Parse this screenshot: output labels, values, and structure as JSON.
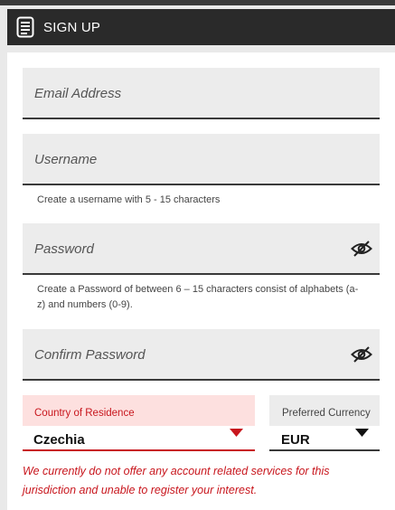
{
  "header": {
    "title": "SIGN UP",
    "icon": "document-icon"
  },
  "form": {
    "email_placeholder": "Email Address",
    "username_placeholder": "Username",
    "username_hint": "Create a username with 5 - 15 characters",
    "password_placeholder": "Password",
    "password_hint_line1": "Create a Password of between 6 – 15 characters consist of alphabets (a-",
    "password_hint_line2": "z) and numbers (0-9).",
    "confirm_password_placeholder": "Confirm Password",
    "country_label": "Country of Residence",
    "country_value": "Czechia",
    "currency_label": "Preferred Currency",
    "currency_value": "EUR",
    "error_line1": "We currently do not offer any account related services for this",
    "error_line2": "jurisdiction and unable to register your interest."
  },
  "colors": {
    "error": "#c8161d",
    "error_bg": "#fde0df",
    "header_bg": "#2a2a2a"
  }
}
